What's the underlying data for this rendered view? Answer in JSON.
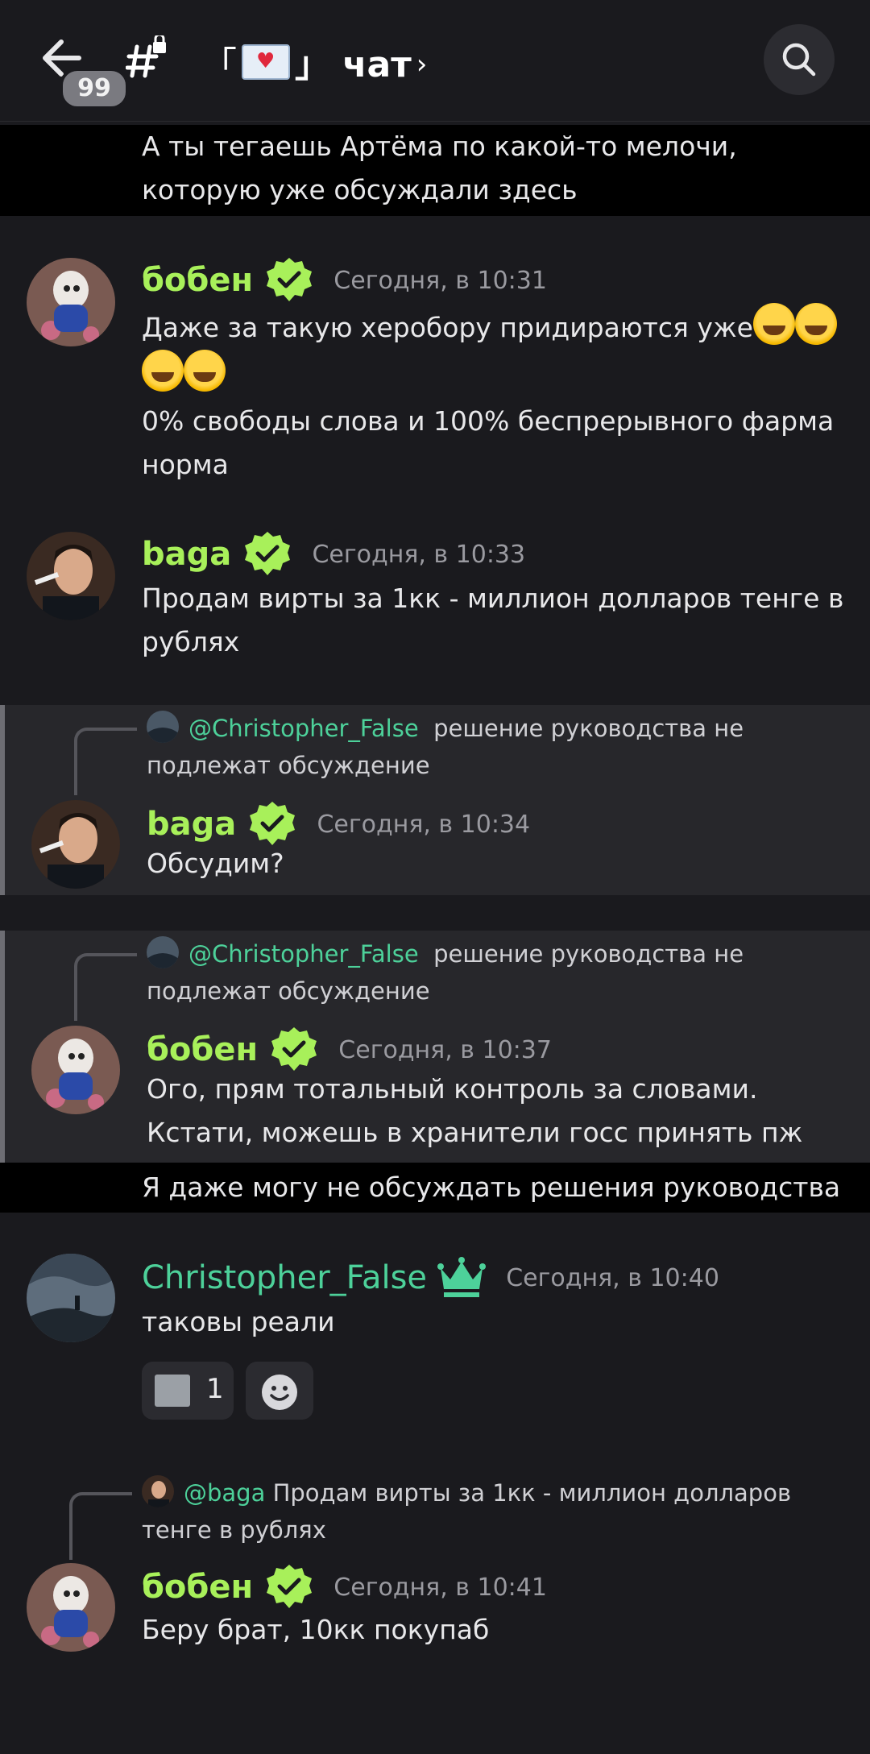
{
  "header": {
    "unread_badge": "99",
    "channel_title_left": "「",
    "channel_title_right": "」 чат",
    "chevron": "›"
  },
  "messages": {
    "m0": {
      "text": "А ты тегаешь Артёма по какой-то мелочи, которую уже обсуждали здесь"
    },
    "m1": {
      "author": "бобен",
      "time": "Сегодня, в 10:31",
      "line1": "Даже за такую херобору придираются уже",
      "line2": "0% свободы слова и 100% беспрерывного фарма норма"
    },
    "m2": {
      "author": "baga",
      "time": "Сегодня, в 10:33",
      "text": "Продам вирты за 1кк - миллион долларов тенге в рублях"
    },
    "m3": {
      "reply_mention": "@Christopher_False",
      "reply_text": "решение руководства не подлежат обсуждение",
      "author": "baga",
      "time": "Сегодня, в 10:34",
      "text": "Обсудим?"
    },
    "m4": {
      "reply_mention": "@Christopher_False",
      "reply_text": "решение руководства не подлежат обсуждение",
      "author": "бобен",
      "time": "Сегодня, в 10:37",
      "text": "Ого, прям тотальный контроль за словами. Кстати, можешь в хранители госс принять пж"
    },
    "m5": {
      "text": "Я даже могу не обсуждать решения руководства"
    },
    "m6": {
      "author": "Christopher_False",
      "time": "Сегодня, в 10:40",
      "text": "таковы реали",
      "reaction_count": "1"
    },
    "m7": {
      "reply_mention": "@baga",
      "reply_text": "Продам вирты за 1кк - миллион долларов тенге в рублях",
      "author": "бобен",
      "time": "Сегодня, в 10:41",
      "text": "Беру брат, 10кк покупаб"
    }
  },
  "icons": {
    "back": "arrow-left-icon",
    "channel": "hashtag-lock-icon",
    "search": "search-icon",
    "verified": "verified-badge-icon",
    "crown": "crown-icon",
    "emoji": "rofl-emoji-icon",
    "add_reaction": "add-reaction-icon"
  },
  "colors": {
    "background": "#1a1a1e",
    "name_green": "#a8f05a",
    "name_teal": "#4dd19a",
    "reply_bg": "#27272b",
    "highlight": "#000000"
  }
}
